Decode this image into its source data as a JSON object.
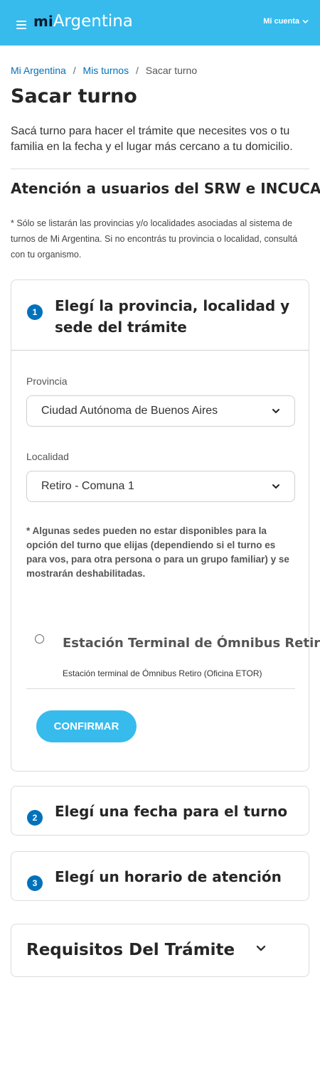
{
  "header": {
    "logo_mi": "mi",
    "logo_argentina": "Argentina",
    "account_label": "Mi cuenta"
  },
  "breadcrumb": {
    "items": [
      "Mi Argentina",
      "Mis turnos"
    ],
    "separator": "/",
    "current": "Sacar turno"
  },
  "page": {
    "title": "Sacar turno",
    "intro": "Sacá turno para hacer el trámite que necesites vos o tu familia en la fecha y el lugar más cercano a tu domicilio.",
    "subtitle": "Atención a usuarios del SRW e INCUCAI",
    "note": "* Sólo se listarán las provincias y/o localidades asociadas al sistema de turnos de Mi Argentina. Si no encontrás tu provincia o localidad, consultá con tu organismo."
  },
  "steps": [
    {
      "number": "1",
      "title": "Elegí la provincia, localidad y sede del trámite",
      "provincia_label": "Provincia",
      "provincia_value": "Ciudad Autónoma de Buenos Aires",
      "localidad_label": "Localidad",
      "localidad_value": "Retiro - Comuna 1",
      "disclaimer": "* Algunas sedes pueden no estar disponibles para la opción del turno que elijas (dependiendo si el turno es para vos, para otra persona o para un grupo familiar) y se mostrarán deshabilitadas.",
      "sede_name": "Estación Terminal de Ómnibus Retiro",
      "sede_detail": "Estación terminal de Ómnibus Retiro (Oficina ETOR)",
      "confirm_label": "CONFIRMAR"
    },
    {
      "number": "2",
      "title": "Elegí una fecha para el turno"
    },
    {
      "number": "3",
      "title": "Elegí un horario de atención"
    }
  ],
  "requisitos": {
    "title": "Requisitos Del Trámite"
  },
  "colors": {
    "header_bg": "#37bbed",
    "link": "#0072bb",
    "step_badge": "#0072bb",
    "button": "#37bbed"
  },
  "icons": {
    "menu": "hamburger-icon",
    "account_chevron": "chevron-down-icon",
    "select_chevron": "chevron-down-icon",
    "requisitos_chevron": "chevron-down-icon"
  }
}
